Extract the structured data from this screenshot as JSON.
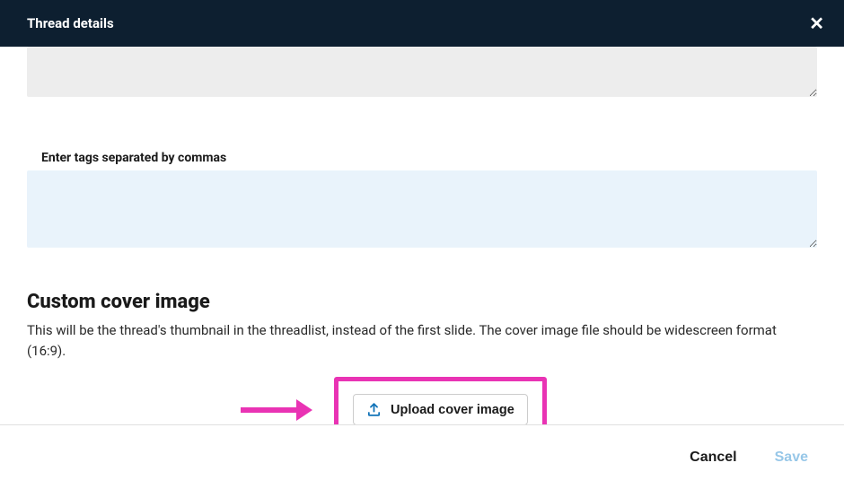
{
  "header": {
    "title": "Thread details"
  },
  "form": {
    "tags_label": "Enter tags separated by commas",
    "tags_value": "",
    "top_textarea_value": ""
  },
  "cover": {
    "heading": "Custom cover image",
    "description": "This will be the thread's thumbnail in the threadlist, instead of the first slide. The cover image file should be widescreen format (16:9).",
    "upload_label": "Upload cover image"
  },
  "footer": {
    "cancel_label": "Cancel",
    "save_label": "Save"
  }
}
